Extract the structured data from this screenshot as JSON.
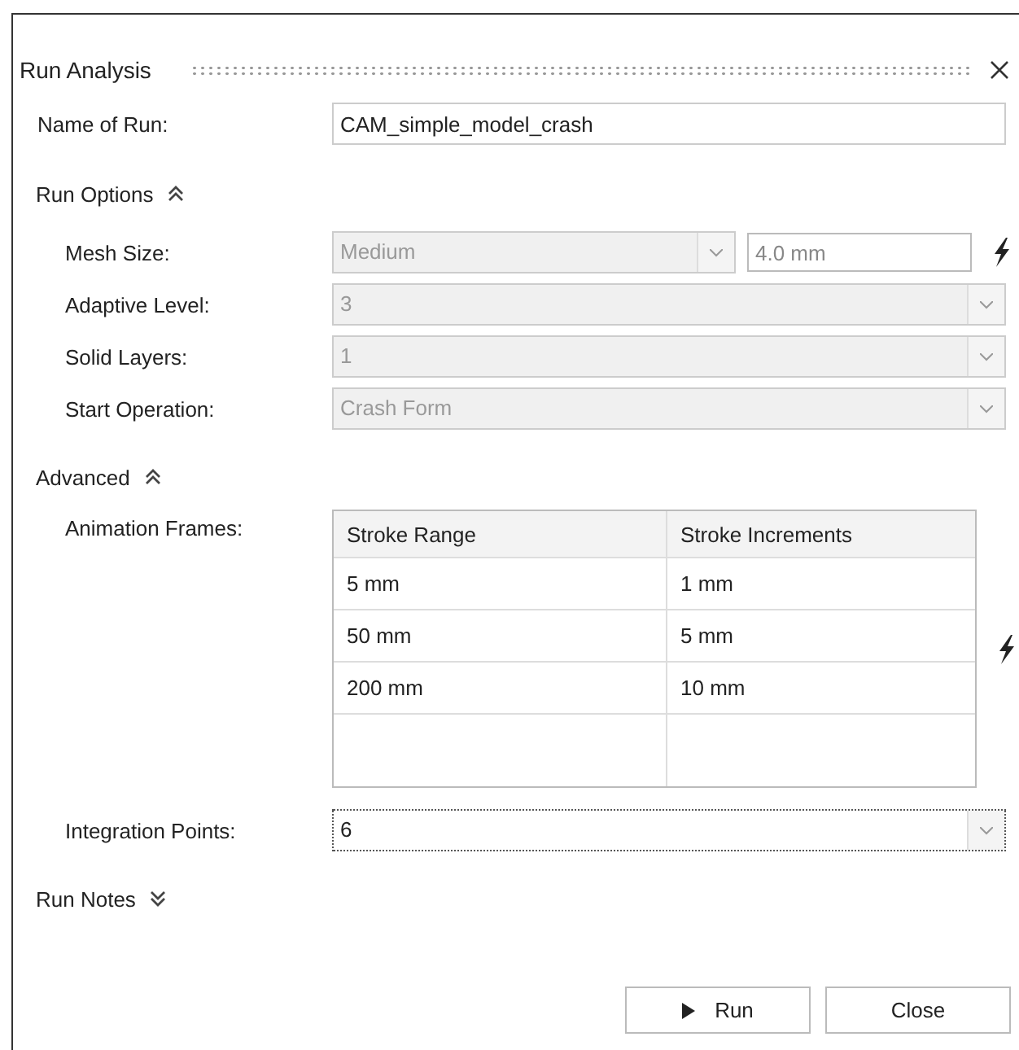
{
  "dialog": {
    "title": "Run Analysis"
  },
  "name_of_run": {
    "label": "Name of Run:",
    "value": "CAM_simple_model_crash"
  },
  "sections": [
    {
      "title": "Run Options",
      "expanded": true,
      "fields": [
        {
          "label": "Mesh Size:",
          "value": "Medium",
          "disabled": true,
          "size_value": "4.0 mm",
          "focused": false
        },
        {
          "label": "Adaptive Level:",
          "value": "3",
          "disabled": true,
          "focused": false
        },
        {
          "label": "Solid Layers:",
          "value": "1",
          "disabled": true,
          "focused": false
        },
        {
          "label": "Start Operation:",
          "value": "Crash Form",
          "disabled": true,
          "focused": false
        }
      ]
    },
    {
      "title": "Advanced",
      "expanded": true,
      "animation_frames": {
        "label": "Animation Frames:",
        "columns": [
          "Stroke Range",
          "Stroke Increments"
        ],
        "rows": [
          [
            "5 mm",
            "1 mm"
          ],
          [
            "50 mm",
            "5 mm"
          ],
          [
            "200 mm",
            "10 mm"
          ]
        ]
      },
      "fields": [
        {
          "label": "Integration Points:",
          "value": "6",
          "disabled": false,
          "focused": true
        }
      ]
    },
    {
      "title": "Run Notes",
      "expanded": false
    }
  ],
  "buttons": [
    {
      "label": "Run",
      "kind": "run"
    },
    {
      "label": "Close",
      "kind": "close"
    }
  ]
}
